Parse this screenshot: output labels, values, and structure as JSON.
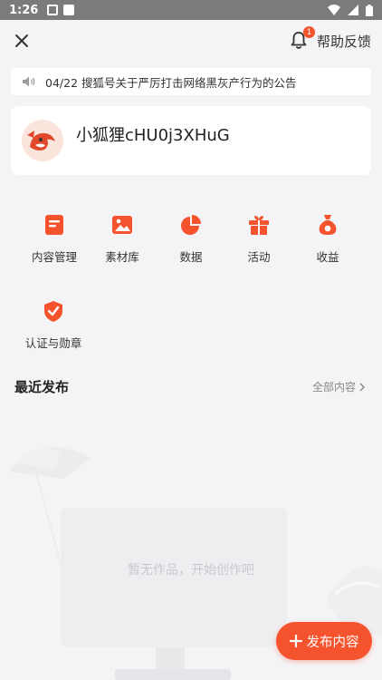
{
  "statusbar": {
    "time": "1:26"
  },
  "header": {
    "help_label": "帮助反馈",
    "bell_badge": "1"
  },
  "notice": {
    "text": "04/22 搜狐号关于严厉打击网络黑灰产行为的公告"
  },
  "profile": {
    "username": "小狐狸cHU0j3XHuG"
  },
  "functions": [
    {
      "label": "内容管理",
      "icon": "document-icon"
    },
    {
      "label": "素材库",
      "icon": "image-icon"
    },
    {
      "label": "数据",
      "icon": "pie-chart-icon"
    },
    {
      "label": "活动",
      "icon": "gift-icon"
    },
    {
      "label": "收益",
      "icon": "money-bag-icon"
    },
    {
      "label": "认证与勋章",
      "icon": "shield-check-icon"
    }
  ],
  "recent": {
    "title": "最近发布",
    "all_label": "全部内容"
  },
  "empty": {
    "text": "暂无作品，开始创作吧"
  },
  "fab": {
    "label": "发布内容"
  },
  "colors": {
    "accent": "#f5532d",
    "background": "#f4f4f6"
  }
}
